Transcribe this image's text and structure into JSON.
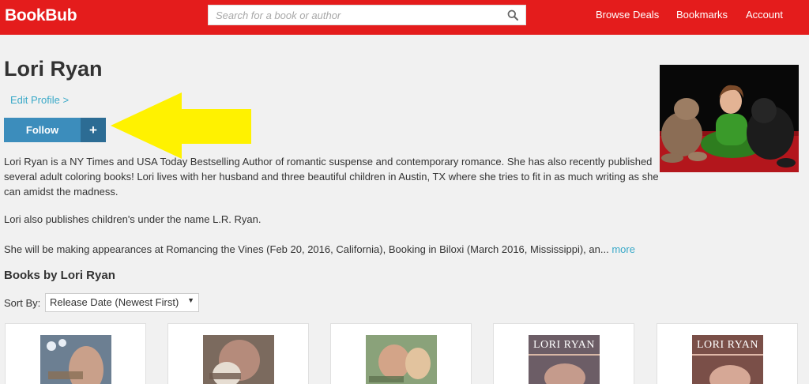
{
  "header": {
    "brand": "BookBub",
    "search_placeholder": "Search for a book or author",
    "nav": [
      "Browse Deals",
      "Bookmarks",
      "Account"
    ],
    "accent": "#e41c1c"
  },
  "author": {
    "name": "Lori Ryan",
    "edit_profile": "Edit Profile >",
    "follow": "Follow",
    "follow_plus": "+",
    "bio": [
      "Lori Ryan is a NY Times and USA Today Bestselling Author of romantic suspense and contemporary romance. She has also recently published several adult coloring books! Lori lives with her husband and three beautiful children in Austin, TX where she tries to fit in as much writing as she can amidst the madness.",
      "Lori also publishes children's under the  name L.R. Ryan.",
      "She will be making appearances at Romancing the Vines (Feb 20, 2016, California), Booking in Biloxi (March 2016, Mississippi), an..."
    ],
    "more": "more"
  },
  "books": {
    "heading": "Books by Lori Ryan",
    "sort_label": "Sort By:",
    "sort_value": "Release Date (Newest First)",
    "cover_titles": [
      "",
      "",
      "",
      "LORI RYAN",
      "LORI RYAN"
    ]
  },
  "icons": {
    "search": "search-icon",
    "dropdown": "chevron-down-icon",
    "annotation": "arrow-left-icon"
  }
}
